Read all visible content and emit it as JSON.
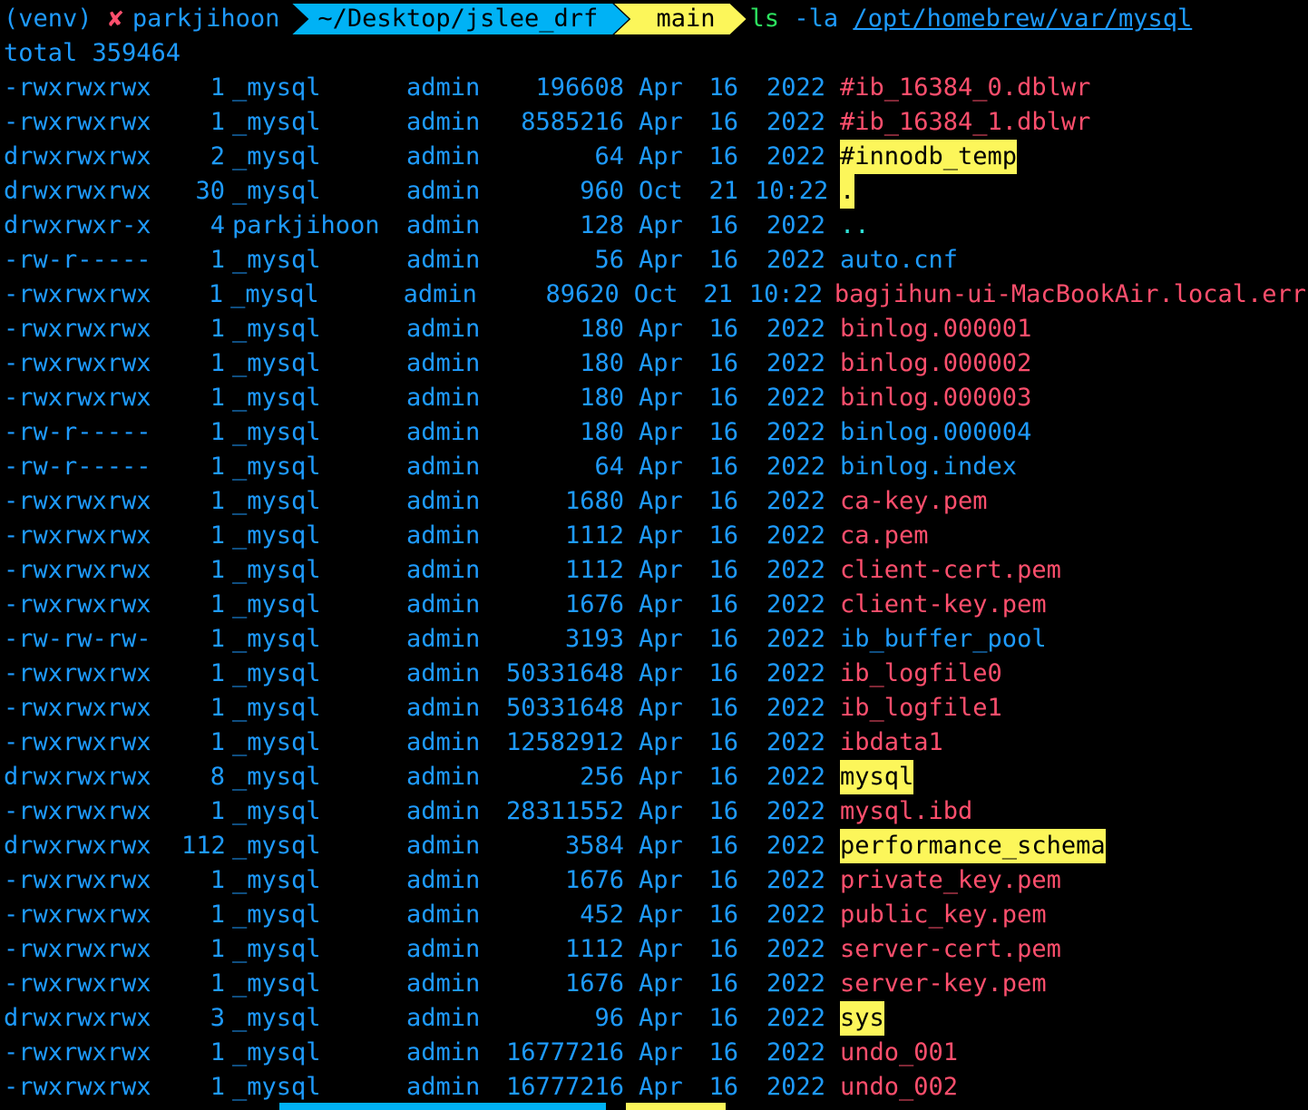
{
  "prompt": {
    "venv": "(venv)",
    "status_mark": "✘",
    "user": "parkjihoon",
    "path": "~/Desktop/jslee_drf",
    "branch_icon": "",
    "branch": "main",
    "command": "ls",
    "flag": "-la",
    "target": "/opt/homebrew/var/mysql"
  },
  "total_line": "total 359464",
  "colors": {
    "background": "#000000",
    "default_text": "#1e9bff",
    "file_name": "#ff4f6d",
    "dir_highlight_bg": "#fcf65a",
    "path_segment_bg": "#00b2f5",
    "command": "#2de35f"
  },
  "listing": [
    {
      "perm": "-rwxrwxrwx",
      "links": "1",
      "owner": "_mysql",
      "group": "admin",
      "size": "196608",
      "month": "Apr",
      "day": "16",
      "time": "2022",
      "name": "#ib_16384_0.dblwr",
      "kind": "file"
    },
    {
      "perm": "-rwxrwxrwx",
      "links": "1",
      "owner": "_mysql",
      "group": "admin",
      "size": "8585216",
      "month": "Apr",
      "day": "16",
      "time": "2022",
      "name": "#ib_16384_1.dblwr",
      "kind": "file"
    },
    {
      "perm": "drwxrwxrwx",
      "links": "2",
      "owner": "_mysql",
      "group": "admin",
      "size": "64",
      "month": "Apr",
      "day": "16",
      "time": "2022",
      "name": "#innodb_temp",
      "kind": "dir"
    },
    {
      "perm": "drwxrwxrwx",
      "links": "30",
      "owner": "_mysql",
      "group": "admin",
      "size": "960",
      "month": "Oct",
      "day": "21",
      "time": "10:22",
      "name": ".",
      "kind": "dir"
    },
    {
      "perm": "drwxrwxr-x",
      "links": "4",
      "owner": "parkjihoon",
      "group": "admin",
      "size": "128",
      "month": "Apr",
      "day": "16",
      "time": "2022",
      "name": "..",
      "kind": "dotdot"
    },
    {
      "perm": "-rw-r-----",
      "links": "1",
      "owner": "_mysql",
      "group": "admin",
      "size": "56",
      "month": "Apr",
      "day": "16",
      "time": "2022",
      "name": "auto.cnf",
      "kind": "plain"
    },
    {
      "perm": "-rwxrwxrwx",
      "links": "1",
      "owner": "_mysql",
      "group": "admin",
      "size": "89620",
      "month": "Oct",
      "day": "21",
      "time": "10:22",
      "name": "bagjihun-ui-MacBookAir.local.err",
      "kind": "file"
    },
    {
      "perm": "-rwxrwxrwx",
      "links": "1",
      "owner": "_mysql",
      "group": "admin",
      "size": "180",
      "month": "Apr",
      "day": "16",
      "time": "2022",
      "name": "binlog.000001",
      "kind": "file"
    },
    {
      "perm": "-rwxrwxrwx",
      "links": "1",
      "owner": "_mysql",
      "group": "admin",
      "size": "180",
      "month": "Apr",
      "day": "16",
      "time": "2022",
      "name": "binlog.000002",
      "kind": "file"
    },
    {
      "perm": "-rwxrwxrwx",
      "links": "1",
      "owner": "_mysql",
      "group": "admin",
      "size": "180",
      "month": "Apr",
      "day": "16",
      "time": "2022",
      "name": "binlog.000003",
      "kind": "file"
    },
    {
      "perm": "-rw-r-----",
      "links": "1",
      "owner": "_mysql",
      "group": "admin",
      "size": "180",
      "month": "Apr",
      "day": "16",
      "time": "2022",
      "name": "binlog.000004",
      "kind": "plain"
    },
    {
      "perm": "-rw-r-----",
      "links": "1",
      "owner": "_mysql",
      "group": "admin",
      "size": "64",
      "month": "Apr",
      "day": "16",
      "time": "2022",
      "name": "binlog.index",
      "kind": "plain"
    },
    {
      "perm": "-rwxrwxrwx",
      "links": "1",
      "owner": "_mysql",
      "group": "admin",
      "size": "1680",
      "month": "Apr",
      "day": "16",
      "time": "2022",
      "name": "ca-key.pem",
      "kind": "file"
    },
    {
      "perm": "-rwxrwxrwx",
      "links": "1",
      "owner": "_mysql",
      "group": "admin",
      "size": "1112",
      "month": "Apr",
      "day": "16",
      "time": "2022",
      "name": "ca.pem",
      "kind": "file"
    },
    {
      "perm": "-rwxrwxrwx",
      "links": "1",
      "owner": "_mysql",
      "group": "admin",
      "size": "1112",
      "month": "Apr",
      "day": "16",
      "time": "2022",
      "name": "client-cert.pem",
      "kind": "file"
    },
    {
      "perm": "-rwxrwxrwx",
      "links": "1",
      "owner": "_mysql",
      "group": "admin",
      "size": "1676",
      "month": "Apr",
      "day": "16",
      "time": "2022",
      "name": "client-key.pem",
      "kind": "file"
    },
    {
      "perm": "-rw-rw-rw-",
      "links": "1",
      "owner": "_mysql",
      "group": "admin",
      "size": "3193",
      "month": "Apr",
      "day": "16",
      "time": "2022",
      "name": "ib_buffer_pool",
      "kind": "plain"
    },
    {
      "perm": "-rwxrwxrwx",
      "links": "1",
      "owner": "_mysql",
      "group": "admin",
      "size": "50331648",
      "month": "Apr",
      "day": "16",
      "time": "2022",
      "name": "ib_logfile0",
      "kind": "file"
    },
    {
      "perm": "-rwxrwxrwx",
      "links": "1",
      "owner": "_mysql",
      "group": "admin",
      "size": "50331648",
      "month": "Apr",
      "day": "16",
      "time": "2022",
      "name": "ib_logfile1",
      "kind": "file"
    },
    {
      "perm": "-rwxrwxrwx",
      "links": "1",
      "owner": "_mysql",
      "group": "admin",
      "size": "12582912",
      "month": "Apr",
      "day": "16",
      "time": "2022",
      "name": "ibdata1",
      "kind": "file"
    },
    {
      "perm": "drwxrwxrwx",
      "links": "8",
      "owner": "_mysql",
      "group": "admin",
      "size": "256",
      "month": "Apr",
      "day": "16",
      "time": "2022",
      "name": "mysql",
      "kind": "dir"
    },
    {
      "perm": "-rwxrwxrwx",
      "links": "1",
      "owner": "_mysql",
      "group": "admin",
      "size": "28311552",
      "month": "Apr",
      "day": "16",
      "time": "2022",
      "name": "mysql.ibd",
      "kind": "file"
    },
    {
      "perm": "drwxrwxrwx",
      "links": "112",
      "owner": "_mysql",
      "group": "admin",
      "size": "3584",
      "month": "Apr",
      "day": "16",
      "time": "2022",
      "name": "performance_schema",
      "kind": "dir"
    },
    {
      "perm": "-rwxrwxrwx",
      "links": "1",
      "owner": "_mysql",
      "group": "admin",
      "size": "1676",
      "month": "Apr",
      "day": "16",
      "time": "2022",
      "name": "private_key.pem",
      "kind": "file"
    },
    {
      "perm": "-rwxrwxrwx",
      "links": "1",
      "owner": "_mysql",
      "group": "admin",
      "size": "452",
      "month": "Apr",
      "day": "16",
      "time": "2022",
      "name": "public_key.pem",
      "kind": "file"
    },
    {
      "perm": "-rwxrwxrwx",
      "links": "1",
      "owner": "_mysql",
      "group": "admin",
      "size": "1112",
      "month": "Apr",
      "day": "16",
      "time": "2022",
      "name": "server-cert.pem",
      "kind": "file"
    },
    {
      "perm": "-rwxrwxrwx",
      "links": "1",
      "owner": "_mysql",
      "group": "admin",
      "size": "1676",
      "month": "Apr",
      "day": "16",
      "time": "2022",
      "name": "server-key.pem",
      "kind": "file"
    },
    {
      "perm": "drwxrwxrwx",
      "links": "3",
      "owner": "_mysql",
      "group": "admin",
      "size": "96",
      "month": "Apr",
      "day": "16",
      "time": "2022",
      "name": "sys",
      "kind": "dir"
    },
    {
      "perm": "-rwxrwxrwx",
      "links": "1",
      "owner": "_mysql",
      "group": "admin",
      "size": "16777216",
      "month": "Apr",
      "day": "16",
      "time": "2022",
      "name": "undo_001",
      "kind": "file"
    },
    {
      "perm": "-rwxrwxrwx",
      "links": "1",
      "owner": "_mysql",
      "group": "admin",
      "size": "16777216",
      "month": "Apr",
      "day": "16",
      "time": "2022",
      "name": "undo_002",
      "kind": "file"
    }
  ]
}
